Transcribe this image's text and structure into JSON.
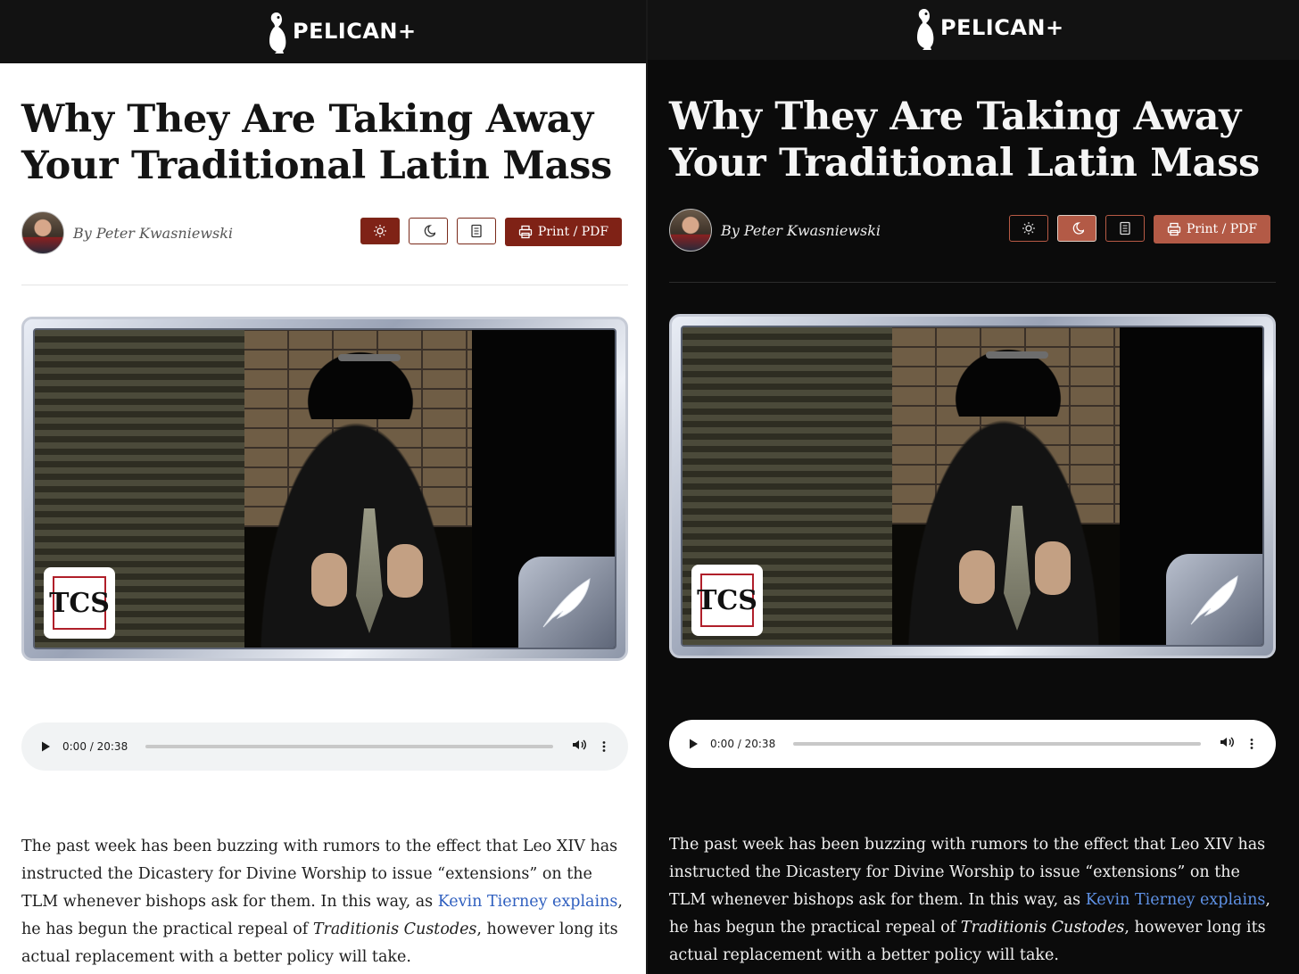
{
  "brand": {
    "name": "PELICAN+"
  },
  "article": {
    "title_line1": "Why They Are Taking Away",
    "title_line2": "Your Traditional Latin Mass",
    "byline": "By Peter Kwasniewski"
  },
  "controls": {
    "light_label": "light-mode",
    "dark_label": "dark-mode",
    "reader_label": "reader-mode",
    "print_label": "Print / PDF"
  },
  "audio": {
    "time": "0:00 / 20:38"
  },
  "image": {
    "logo_text": "TCS"
  },
  "body": {
    "p1_part1": "The past week has been buzzing with rumors to the effect that Leo XIV has instructed the Dicastery for Divine Worship to issue “extensions” on the TLM whenever bishops ask for them. In this way, as ",
    "p1_link": "Kevin Tierney explains",
    "p1_part2": ", he has begun the practical repeal of ",
    "p1_italic": "Traditionis Custodes",
    "p1_part3": ", however long its actual replacement with a better policy will take."
  },
  "colors": {
    "accent": "#7f2216",
    "accent_dark_mode": "#b35a46",
    "link": "#2f5fbf",
    "link_dark_mode": "#5f92e6"
  }
}
